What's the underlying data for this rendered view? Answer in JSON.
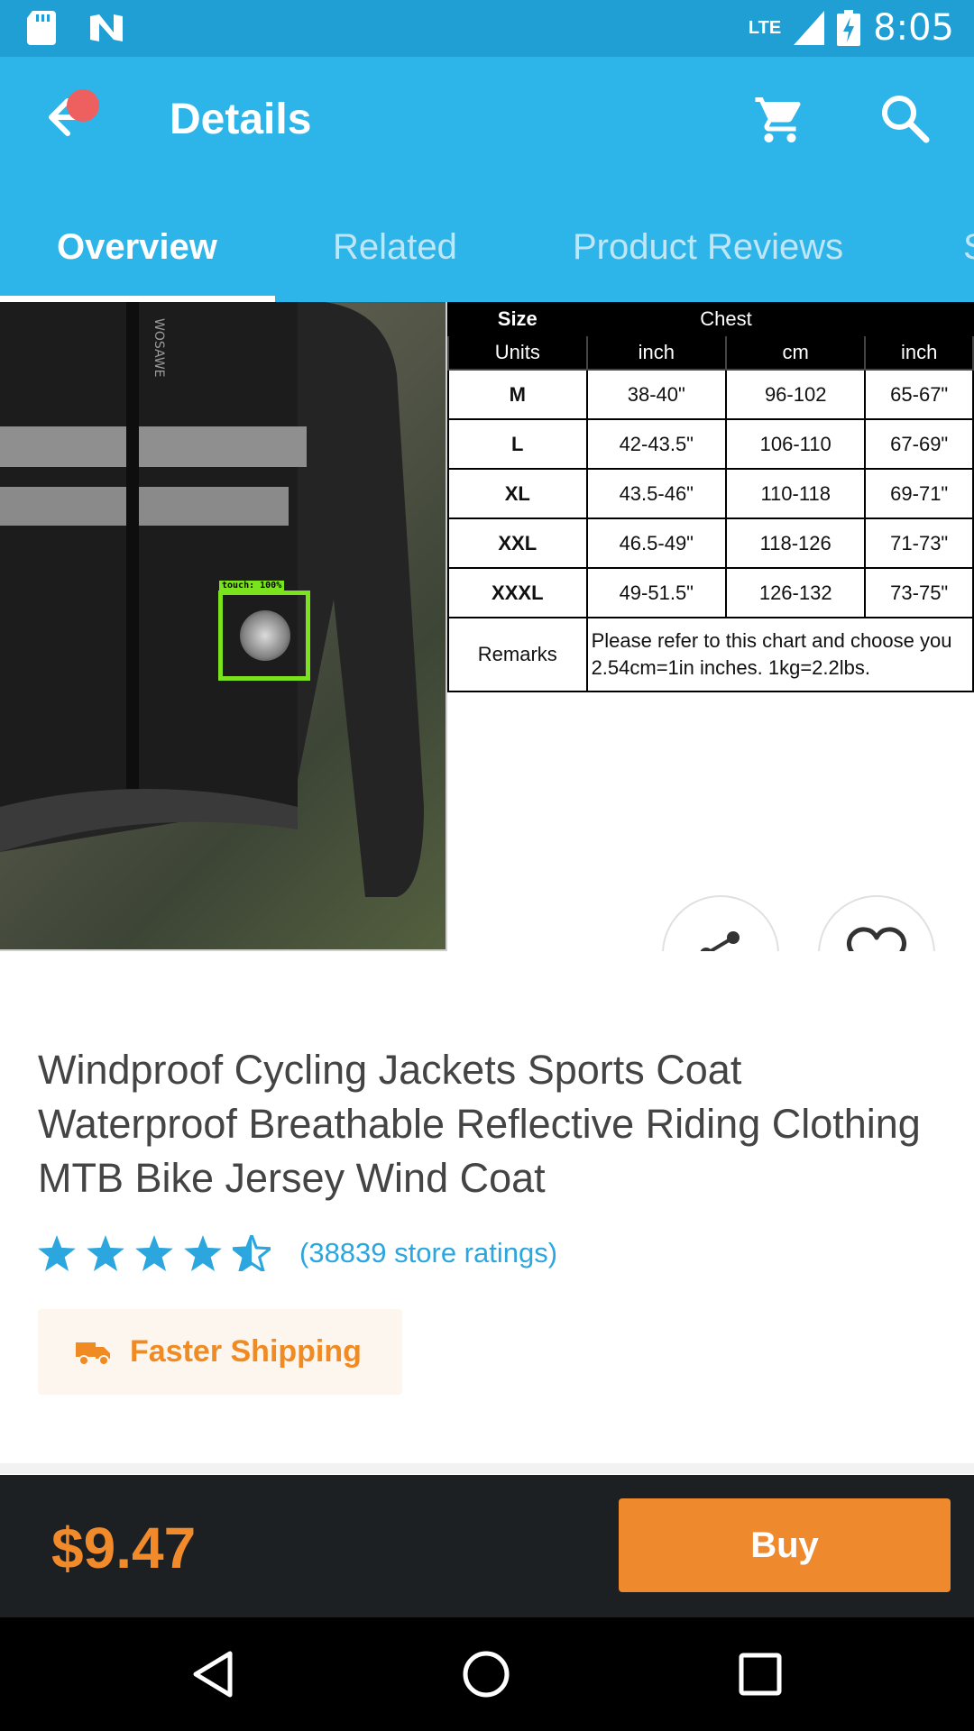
{
  "status_bar": {
    "time": "8:05",
    "network": "LTE",
    "icons": [
      "sd-card-icon",
      "n-notification-icon",
      "signal-icon",
      "battery-charging-icon"
    ]
  },
  "app_bar": {
    "title": "Details",
    "back_icon": "arrow-left-icon",
    "cart_icon": "cart-icon",
    "search_icon": "search-icon"
  },
  "tabs": [
    {
      "label": "Overview",
      "active": true
    },
    {
      "label": "Related",
      "active": false
    },
    {
      "label": "Product Reviews",
      "active": false
    },
    {
      "label": "S",
      "active": false
    }
  ],
  "touch_overlay": {
    "label": "touch: 100%"
  },
  "size_chart": {
    "header": [
      "Size",
      "Chest",
      ""
    ],
    "units": [
      "Units",
      "inch",
      "cm",
      "inch"
    ],
    "rows": [
      [
        "M",
        "38-40\"",
        "96-102",
        "65-67\""
      ],
      [
        "L",
        "42-43.5\"",
        "106-110",
        "67-69\""
      ],
      [
        "XL",
        "43.5-46\"",
        "110-118",
        "69-71\""
      ],
      [
        "XXL",
        "46.5-49\"",
        "118-126",
        "71-73\""
      ],
      [
        "XXXL",
        "49-51.5\"",
        "126-132",
        "73-75\""
      ]
    ],
    "remarks_label": "Remarks",
    "remarks_line1": "Please refer to this chart and choose you",
    "remarks_line2": "2.54cm=1in inches. 1kg=2.2lbs."
  },
  "product": {
    "title": "Windproof Cycling Jackets Sports Coat Waterproof Breathable Reflective Riding Clothing MTB Bike Jersey Wind Coat",
    "rating_stars": 4.5,
    "ratings_text": "(38839 store ratings)",
    "shipping_label": "Faster Shipping",
    "shipping_icon": "truck-icon"
  },
  "purchase": {
    "price": "$9.47",
    "buy_label": "Buy"
  },
  "colors": {
    "status_bar": "#1f9fd3",
    "app_bar": "#2db4e8",
    "accent_orange": "#ee8a2d",
    "star_blue": "#2ba6de"
  }
}
